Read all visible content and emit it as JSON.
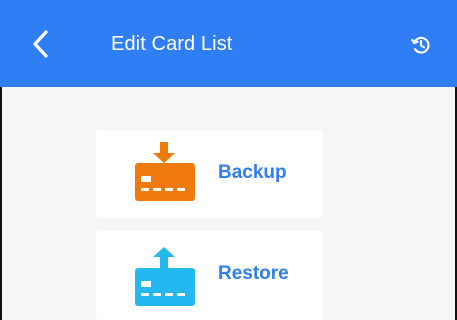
{
  "app_bar": {
    "title": "Edit Card List",
    "back_icon": "chevron-left-icon",
    "history_icon": "history-icon",
    "color": "#2f7ef5"
  },
  "actions": [
    {
      "label": "Backup",
      "icon": "card-download-icon",
      "icon_color": "#f07a0b"
    },
    {
      "label": "Restore",
      "icon": "card-upload-icon",
      "icon_color": "#23b8ef"
    }
  ]
}
